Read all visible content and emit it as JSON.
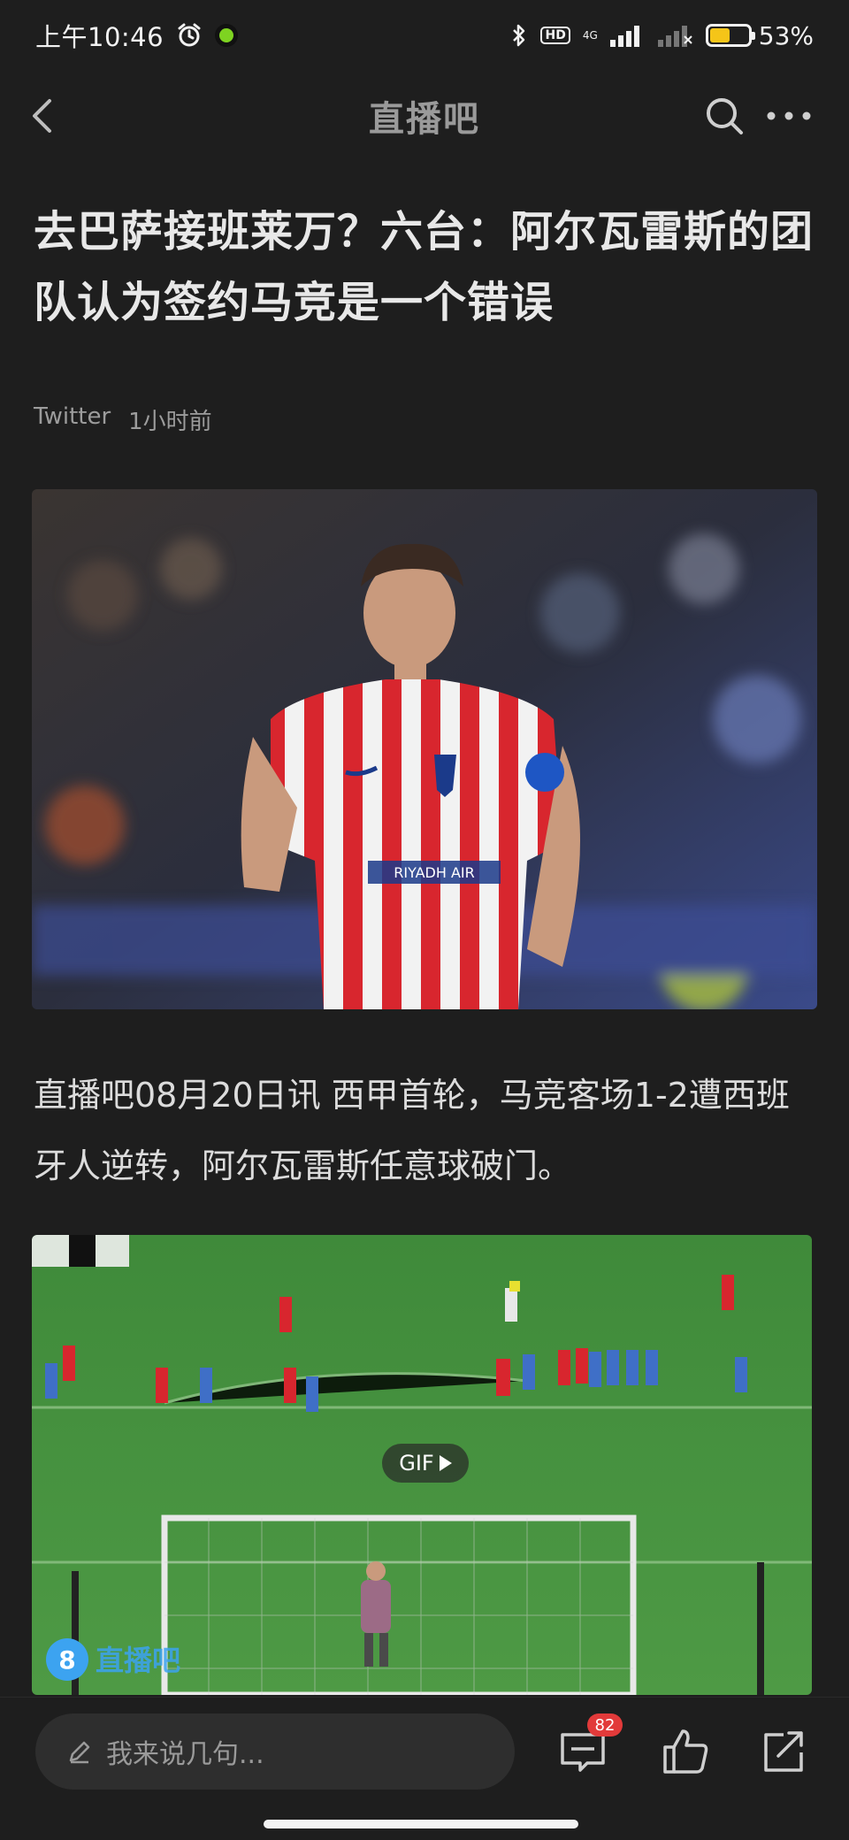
{
  "status_bar": {
    "time": "上午10:46",
    "hd": "HD",
    "network": "4G",
    "battery_percent": "53%",
    "battery_level": 0.53
  },
  "header": {
    "title": "直播吧",
    "icons": [
      "back-arrow-icon",
      "search-icon",
      "more-icon"
    ]
  },
  "article": {
    "headline": "去巴萨接班莱万？六台：阿尔瓦雷斯的团队认为签约马竞是一个错误",
    "source": "Twitter",
    "time_ago": "1小时前",
    "body": "直播吧08月20日讯 西甲首轮，马竞客场1-2遭西班牙人逆转，阿尔瓦雷斯任意球破门。",
    "player_shirt_text": "RIYADH AIR",
    "media_badge": "GIF",
    "watermark": "直播吧"
  },
  "bottom_bar": {
    "comment_placeholder": "我来说几句...",
    "comment_count": "82"
  },
  "colors": {
    "background": "#1e1e1e",
    "text_primary": "#e8e8e8",
    "text_muted": "#9c9c9c",
    "badge_red": "#e23a3a",
    "battery_yellow": "#f5c518"
  }
}
